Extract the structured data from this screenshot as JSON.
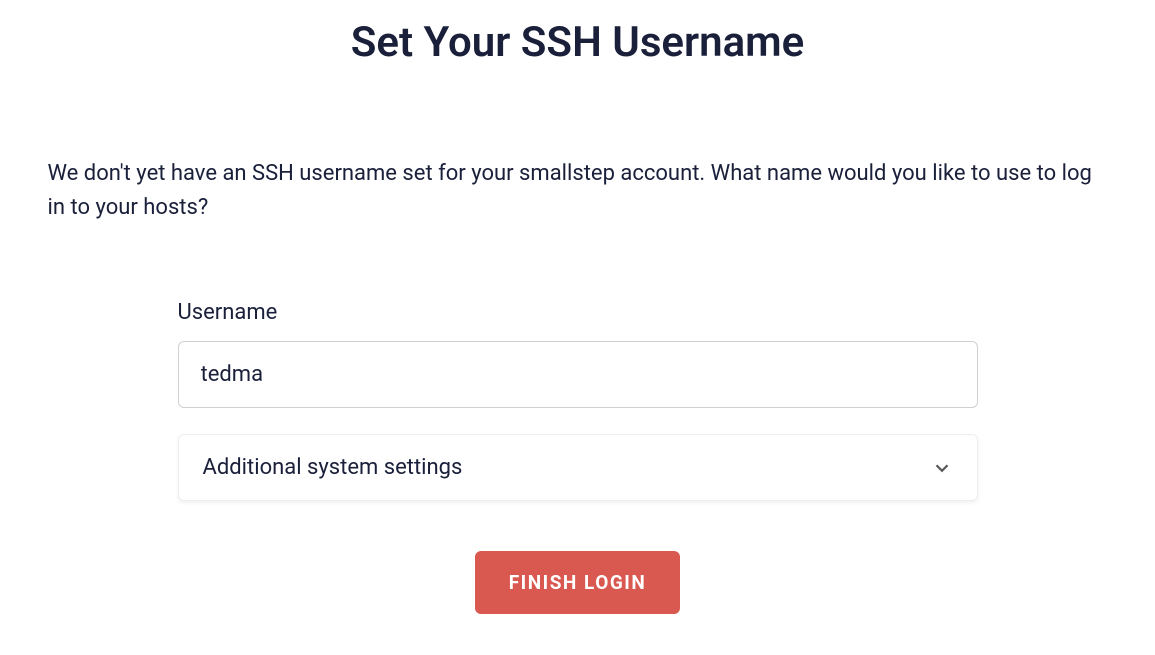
{
  "header": {
    "title": "Set Your SSH Username"
  },
  "description": "We don't yet have an SSH username set for your smallstep account. What name would you like to use to log in to your hosts?",
  "form": {
    "username_label": "Username",
    "username_value": "tedma",
    "settings_panel_label": "Additional system settings"
  },
  "actions": {
    "finish_label": "FINISH LOGIN"
  }
}
